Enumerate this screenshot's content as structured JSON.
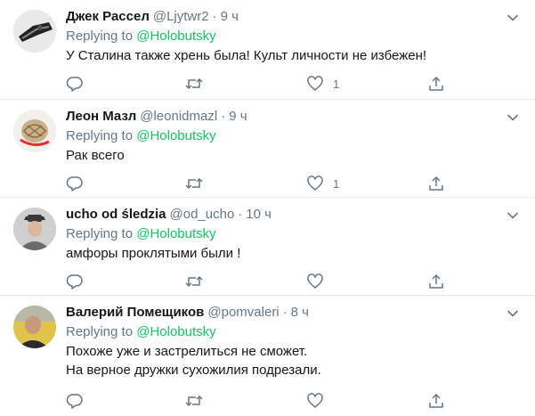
{
  "reply_prefix": "Replying to",
  "tweets": [
    {
      "name": "Джек Рассел",
      "handle": "@Ljytwr2",
      "dot": "·",
      "time": "9 ч",
      "reply_to": "@Holobutsky",
      "text_lines": [
        "У Сталина также хрень была! Культ личности не избежен!"
      ],
      "likes": "1"
    },
    {
      "name": "Леон Мазл",
      "handle": "@leonidmazl",
      "dot": "·",
      "time": "9 ч",
      "reply_to": "@Holobutsky",
      "text_lines": [
        "Рак всего"
      ],
      "likes": "1"
    },
    {
      "name": "ucho od śledzia",
      "handle": "@od_ucho",
      "dot": "·",
      "time": "10 ч",
      "reply_to": "@Holobutsky",
      "text_lines": [
        "амфоры проклятыми были !"
      ],
      "likes": ""
    },
    {
      "name": "Валерий Помещиков",
      "handle": "@pomvaleri",
      "dot": "·",
      "time": "8 ч",
      "reply_to": "@Holobutsky",
      "text_lines": [
        "Похоже уже и застрелиться не сможет.",
        "На верное дружки сухожилия подрезали."
      ],
      "likes": ""
    }
  ],
  "icons": {
    "reply": "reply-icon",
    "retweet": "retweet-icon",
    "like": "heart-icon",
    "share": "share-icon",
    "caret": "chevron-down-icon"
  },
  "colors": {
    "text": "#14171a",
    "muted": "#657786",
    "mention": "#17bf63",
    "divider": "#e6ecf0"
  }
}
